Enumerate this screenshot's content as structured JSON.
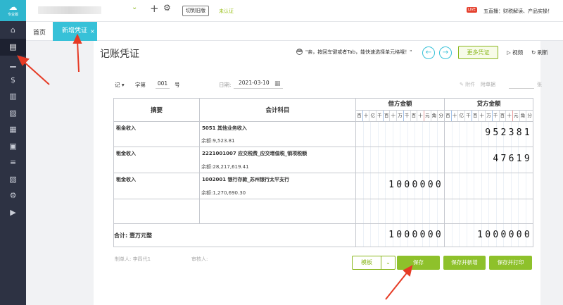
{
  "sidebar": {
    "logo_icon": "cloud-icon",
    "logo_label": "专业版",
    "items": [
      {
        "name": "home-icon",
        "glyph": "⌂"
      },
      {
        "name": "voucher-icon",
        "glyph": "▤",
        "active": true
      },
      {
        "name": "chart-icon",
        "glyph": "▁"
      },
      {
        "name": "money-bag-icon",
        "glyph": "$"
      },
      {
        "name": "ledger-icon",
        "glyph": "▥"
      },
      {
        "name": "image-icon",
        "glyph": "▨"
      },
      {
        "name": "building-icon",
        "glyph": "▦"
      },
      {
        "name": "report-icon",
        "glyph": "▣"
      },
      {
        "name": "stack-icon",
        "glyph": "≡"
      },
      {
        "name": "doc-icon",
        "glyph": "▧"
      },
      {
        "name": "settings-icon",
        "glyph": "⚙"
      },
      {
        "name": "play-icon",
        "glyph": "▶"
      }
    ]
  },
  "topbar": {
    "switch_old": "切到旧版",
    "unverified": "未认证",
    "live_badge": "LIVE",
    "live_text": "五直播：财税解读、产品实操！"
  },
  "tabs": {
    "home": "首页",
    "active": "新增凭证",
    "close": "×"
  },
  "voucher": {
    "title": "记账凭证",
    "tip": "\"亲，按回车键或者Tab，能快速选择单元格哦！\"",
    "more_vouchers": "更多凭证",
    "video": "视频",
    "refresh": "刷新",
    "word": "记",
    "word_label": "字第",
    "number": "001",
    "number_suffix": "号",
    "date_label": "日期:",
    "date": "2021-03-10",
    "attachment": "附件",
    "docs_label": "附单据",
    "docs_unit": "张"
  },
  "table": {
    "col_summary": "摘要",
    "col_account": "会计科目",
    "col_debit": "借方金额",
    "col_credit": "贷方金额",
    "digits": [
      "百",
      "十",
      "亿",
      "千",
      "百",
      "十",
      "万",
      "千",
      "百",
      "十",
      "元",
      "角",
      "分"
    ],
    "balance_label": "余额:",
    "rows": [
      {
        "summary": "租金收入",
        "account": "5051 其他业务收入",
        "balance": "9,523.81",
        "debit": "",
        "credit": "952381"
      },
      {
        "summary": "租金收入",
        "account": "2221001007 应交税费_应交增值税_销项税额",
        "balance": "28,217,619.41",
        "debit": "",
        "credit": "47619"
      },
      {
        "summary": "租金收入",
        "account": "1002001 银行存款_苏州银行太平支行",
        "balance": "1,270,690.30",
        "debit": "1000000",
        "credit": ""
      }
    ],
    "total_label": "合计: 壹万元整",
    "total_debit": "1000000",
    "total_credit": "1000000"
  },
  "footer": {
    "maker": "制单人: 李四代1",
    "auditor": "审核人:",
    "template": "模板",
    "save": "保存",
    "save_new": "保存并新增",
    "save_print": "保存并打印"
  },
  "colors": {
    "accent": "#37c1d8",
    "green": "#8ec12b",
    "sidebar": "#2d3243",
    "annotation": "#e63b25"
  }
}
